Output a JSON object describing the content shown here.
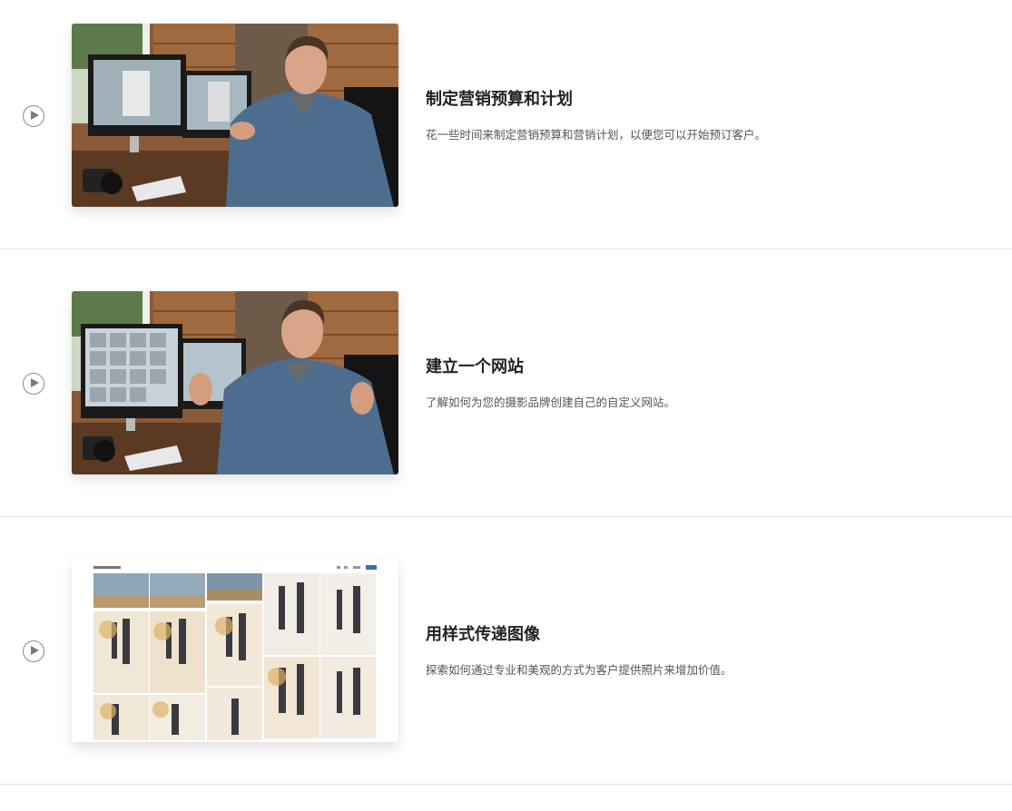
{
  "lessons": [
    {
      "title": "制定营销预算和计划",
      "description": "花一些时间来制定营销预算和营销计划，以便您可以开始预订客户。",
      "thumbnail": "man-at-desk-with-monitors-video"
    },
    {
      "title": "建立一个网站",
      "description": "了解如何为您的摄影品牌创建自己的自定义网站。",
      "thumbnail": "man-gesturing-at-desk-video"
    },
    {
      "title": "用样式传递图像",
      "description": "探索如何通过专业和美观的方式为客户提供照片来增加价值。",
      "thumbnail": "beach-family-photo-gallery-website"
    }
  ],
  "icons": {
    "play": "play-circle-icon"
  },
  "colors": {
    "title": "#222222",
    "description": "#555555",
    "divider": "#e3e3e3",
    "play_icon": "#7a7a7a"
  }
}
